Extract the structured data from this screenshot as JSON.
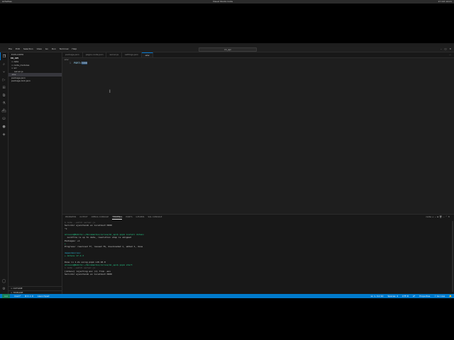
{
  "system_bar": {
    "left": "Activities",
    "center": "Visual Studio Code",
    "right": "17 Oct 14:21"
  },
  "window": {
    "title": "Visual Studio Code — .env - mi_api"
  },
  "menu": [
    "File",
    "Edit",
    "Selection",
    "View",
    "Go",
    "Run",
    "Terminal",
    "Help"
  ],
  "command_center": "mi_api",
  "activity_icons": [
    "files-icon",
    "search-icon",
    "source-control-icon",
    "run-debug-icon",
    "extensions-icon",
    "remote-explorer-icon",
    "testing-icon",
    "docker-icon",
    "database-icon",
    "github-icon",
    "copilot-icon",
    "accounts-icon",
    "settings-icon"
  ],
  "sidebar": {
    "header": "EXPLORER",
    "project": "MI_API",
    "items": [
      {
        "label": "> data",
        "indent": 1
      },
      {
        "label": "> node_modules",
        "indent": 1
      },
      {
        "label": "> src",
        "indent": 1
      },
      {
        "label": "server.js",
        "indent": 2
      },
      {
        "label": ".env",
        "indent": 1,
        "selected": true
      },
      {
        "label": "package.json",
        "indent": 1
      },
      {
        "label": "package-lock.json",
        "indent": 1
      }
    ],
    "bottom": [
      "> OUTLINE",
      "> TIMELINE"
    ]
  },
  "tabs": [
    {
      "label": "package.json",
      "active": false
    },
    {
      "label": "pagos-node.json",
      "active": false
    },
    {
      "label": "server.js",
      "active": false
    },
    {
      "label": "settings.json",
      "active": false
    },
    {
      "label": ".env",
      "active": true
    }
  ],
  "breadcrumb": ".env",
  "editor": {
    "lines": [
      {
        "num": "1",
        "key": "PORT=",
        "value": "3000"
      }
    ]
  },
  "panel": {
    "tabs": [
      {
        "label": "PROBLEMS",
        "active": false
      },
      {
        "label": "OUTPUT",
        "active": false
      },
      {
        "label": "DEBUG CONSOLE",
        "active": false
      },
      {
        "label": "TERMINAL",
        "active": true
      },
      {
        "label": "PORTS",
        "active": false
      },
      {
        "label": "GITLENS",
        "active": false
      },
      {
        "label": "SQL CONSOLE",
        "active": false
      }
    ],
    "actions": "node + ⌄ ⊟ 🗑 … ⌃ ✕",
    "terminal_lines": [
      {
        "text": "$ node --watch server.js",
        "style": "dim"
      },
      {
        "text": "Servidor ejecutando en localhost:3000",
        "style": "plain"
      },
      {
        "text": "^C",
        "style": "plain"
      },
      {
        "text": "",
        "style": "plain"
      },
      {
        "text": "alisson@Nobita:~/Documentos/cursos/mi_api$ pnpm install dotenv",
        "style": "prompt"
      },
      {
        "text": "  Lockfile is up to date, resolution step is skipped",
        "style": "plain"
      },
      {
        "text": "Packages: +1",
        "style": "plain"
      },
      {
        "text": "+",
        "style": "green"
      },
      {
        "text": "Progress: resolved 77, reused 76, downloaded 1, added 1, done",
        "style": "plain"
      },
      {
        "text": "",
        "style": "plain"
      },
      {
        "text": "dependencies:",
        "style": "cyan"
      },
      {
        "text": "+ dotenv 17.2.3",
        "style": "green"
      },
      {
        "text": "",
        "style": "plain"
      },
      {
        "text": "Done in 1.2s using pnpm v10.18.0",
        "style": "plain"
      },
      {
        "text": "alisson@Nobita:~/Documentos/cursos/mi_api$ pnpm start",
        "style": "prompt"
      },
      {
        "text": "> node --watch server.js",
        "style": "dim"
      },
      {
        "text": "[dotenv] injecting env (1) from .env",
        "style": "plain"
      },
      {
        "text": "Servidor ejecutando en localhost:3000",
        "style": "plain"
      }
    ]
  },
  "statusbar": {
    "remote": "><",
    "left": [
      "main*",
      "⊗ 0 ⚠ 0",
      "Launchpad"
    ],
    "right": [
      "Ln 1, Col 10",
      "Spaces: 4",
      "UTF-8",
      "LF",
      "Properties",
      "⚇ Go Live",
      "🔔"
    ]
  }
}
